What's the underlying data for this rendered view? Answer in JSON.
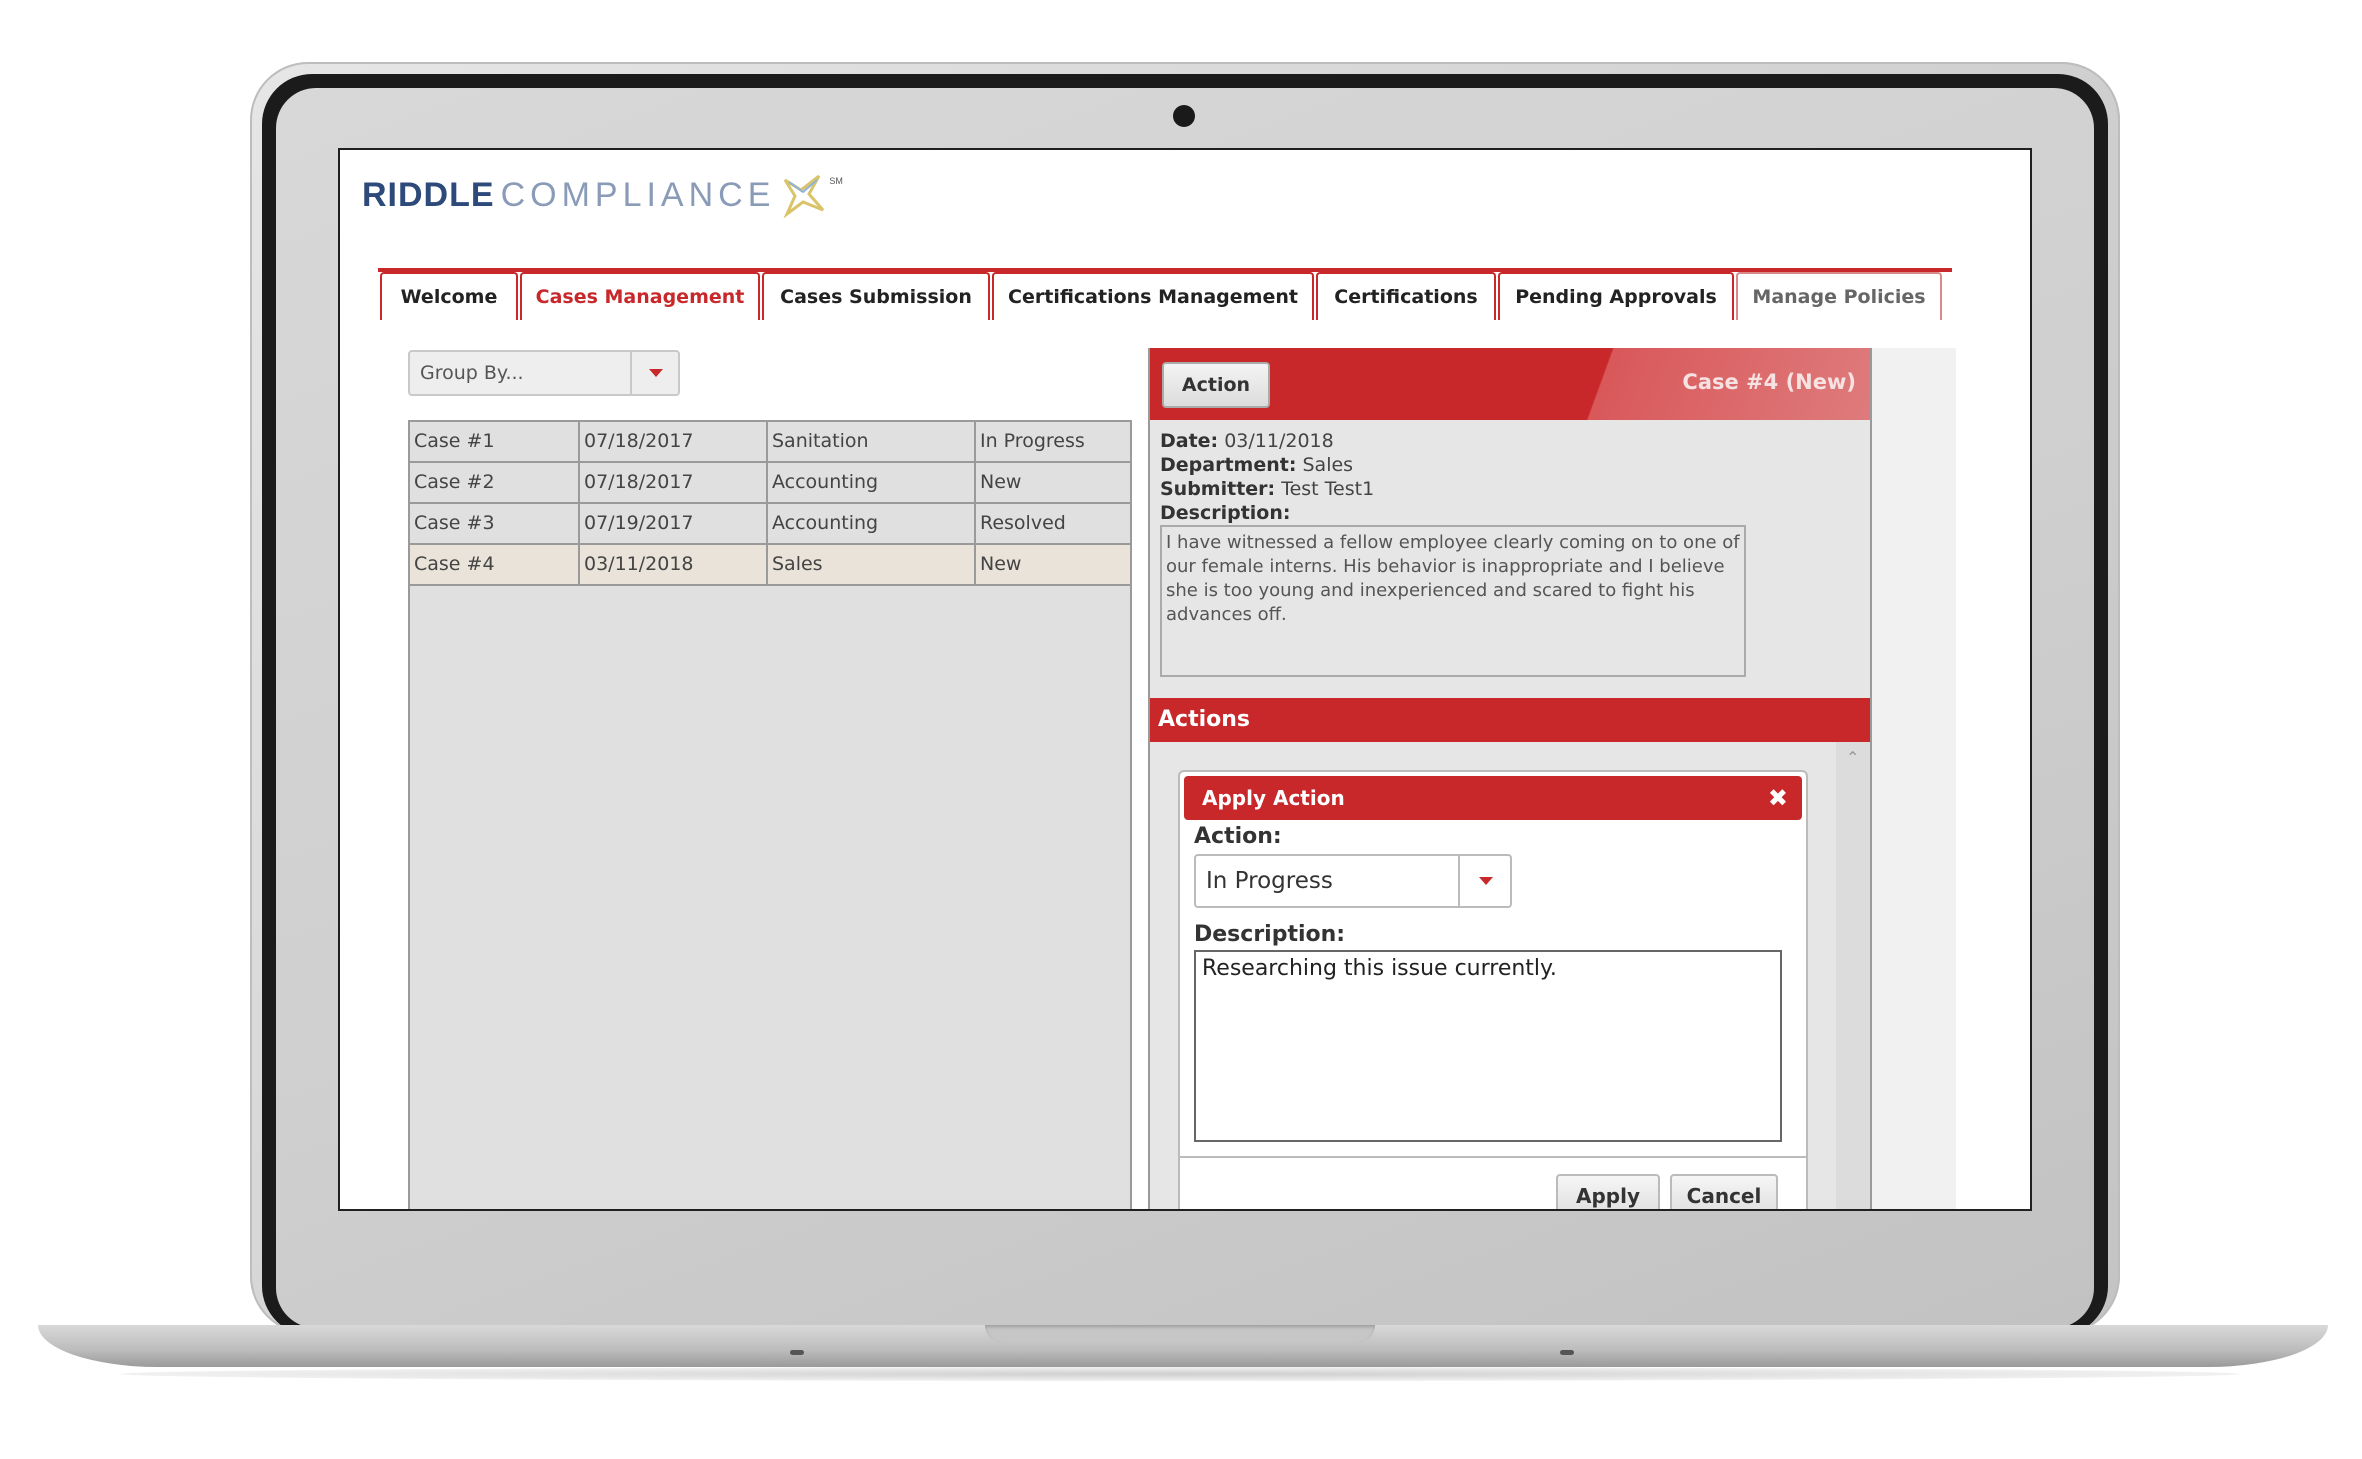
{
  "logo": {
    "brand_a": "RIDDLE",
    "brand_b": "COMPLIANCE",
    "tm": "SM",
    "accent": "#d9c46a"
  },
  "colors": {
    "accent": "#c8282a",
    "brand_blue": "#2d4a7a"
  },
  "tabs": [
    {
      "label": "Welcome",
      "state": "normal"
    },
    {
      "label": "Cases Management",
      "state": "active"
    },
    {
      "label": "Cases Submission",
      "state": "normal"
    },
    {
      "label": "Certifications Management",
      "state": "normal"
    },
    {
      "label": "Certifications",
      "state": "normal"
    },
    {
      "label": "Pending Approvals",
      "state": "normal"
    },
    {
      "label": "Manage Policies",
      "state": "dim"
    }
  ],
  "group_by": {
    "placeholder": "Group By...",
    "icon": "chevron-down-icon"
  },
  "cases": [
    {
      "id": "Case #1",
      "date": "07/18/2017",
      "department": "Sanitation",
      "status": "In Progress"
    },
    {
      "id": "Case #2",
      "date": "07/18/2017",
      "department": "Accounting",
      "status": "New"
    },
    {
      "id": "Case #3",
      "date": "07/19/2017",
      "department": "Accounting",
      "status": "Resolved"
    },
    {
      "id": "Case #4",
      "date": "03/11/2018",
      "department": "Sales",
      "status": "New"
    }
  ],
  "detail": {
    "action_button": "Action",
    "case_title": "Case #4 (New)",
    "date_label": "Date:",
    "date_value": "03/11/2018",
    "department_label": "Department:",
    "department_value": "Sales",
    "submitter_label": "Submitter:",
    "submitter_value": "Test Test1",
    "description_label": "Description:",
    "description_value": "I have witnessed a fellow employee clearly coming on to one of our female interns. His behavior is inappropriate and I believe she is too young and inexperienced and scared to fight his advances off.",
    "actions_header": "Actions"
  },
  "modal": {
    "title": "Apply Action",
    "close_icon": "close-icon",
    "action_label": "Action:",
    "action_value": "In Progress",
    "description_label": "Description:",
    "description_value": "Researching this issue currently.",
    "apply_label": "Apply",
    "cancel_label": "Cancel"
  }
}
